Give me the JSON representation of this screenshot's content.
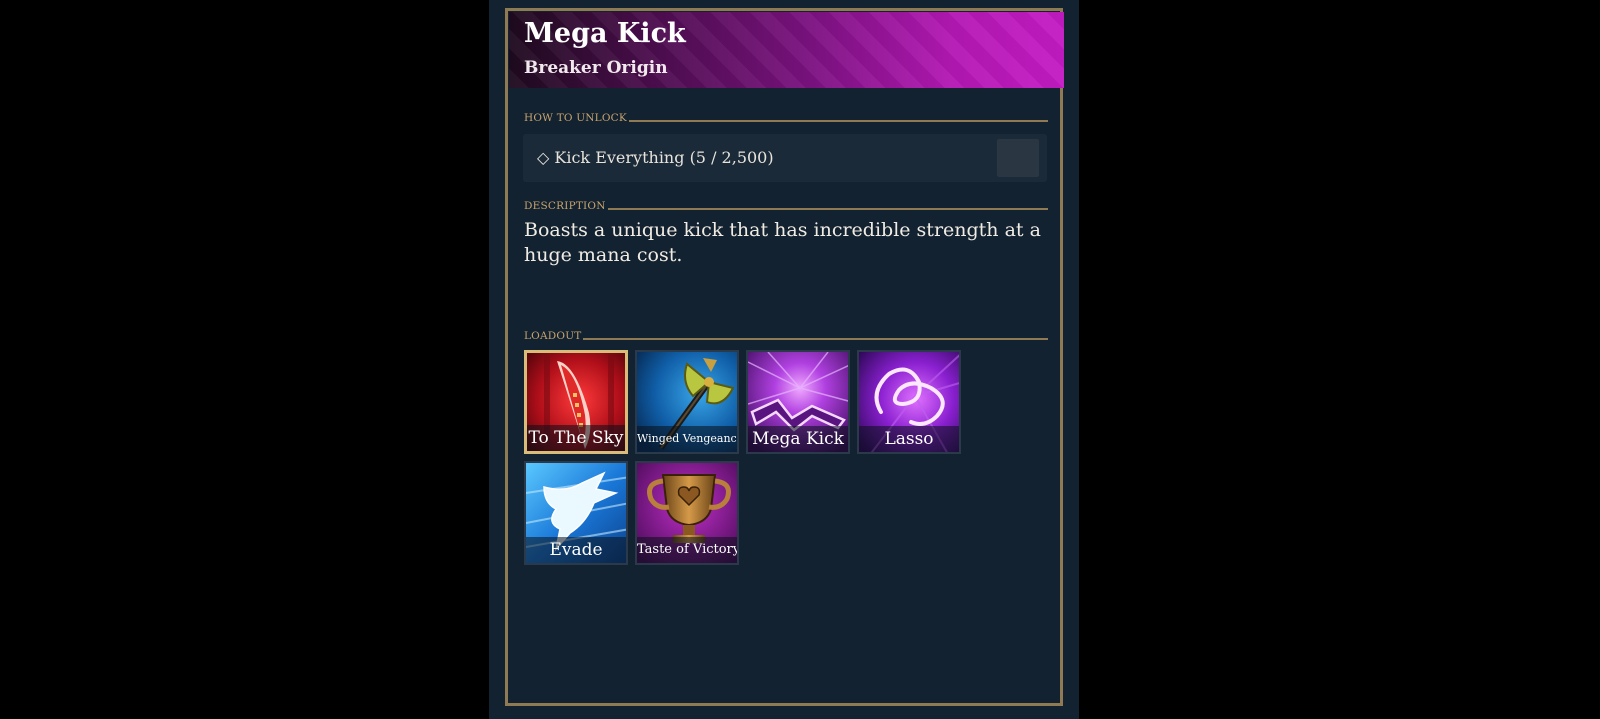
{
  "header": {
    "title": "Mega Kick",
    "subtitle": "Breaker Origin"
  },
  "unlock": {
    "section_label": "HOW TO UNLOCK",
    "requirement": "◇ Kick Everything (5 / 2,500)"
  },
  "description": {
    "section_label": "DESCRIPTION",
    "text": "Boasts a unique kick that has incredible strength at a huge mana cost."
  },
  "loadout": {
    "section_label": "LOADOUT",
    "items": [
      {
        "label": "To The Sky",
        "icon": "red-blade-icon",
        "selected": true
      },
      {
        "label": "Winged Vengeance",
        "icon": "winged-axe-icon",
        "selected": false
      },
      {
        "label": "Mega Kick",
        "icon": "lightning-kick-icon",
        "selected": false
      },
      {
        "label": "Lasso",
        "icon": "energy-lasso-icon",
        "selected": false
      },
      {
        "label": "Evade",
        "icon": "dash-spirit-icon",
        "selected": false
      },
      {
        "label": "Taste of Victory",
        "icon": "trophy-icon",
        "selected": false
      }
    ]
  },
  "colors": {
    "panel_bg": "#132230",
    "frame_gold": "#8f7a54",
    "label_gold": "#c8a46e",
    "header_magenta": "#c41bc4"
  }
}
